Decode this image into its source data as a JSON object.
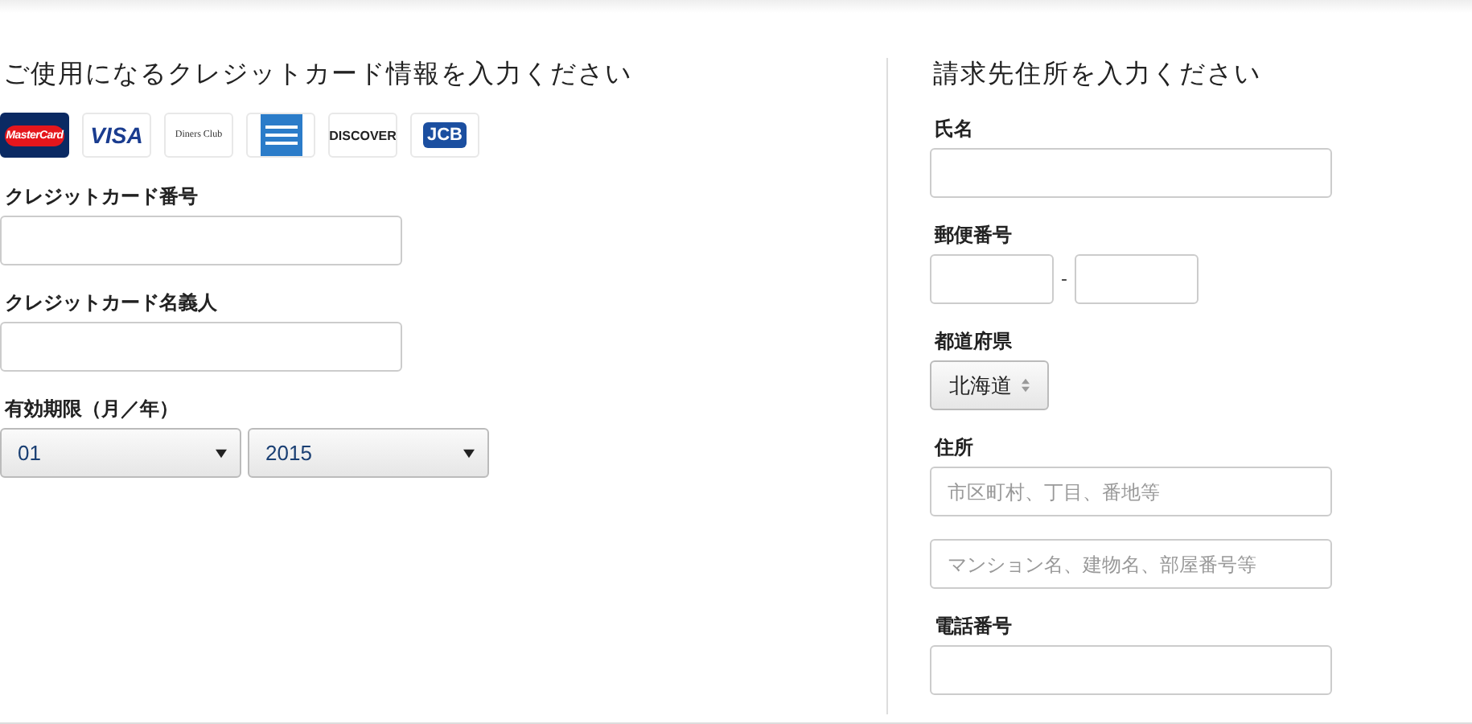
{
  "card_section": {
    "title": "ご使用になるクレジットカード情報を入力ください",
    "card_logos": [
      {
        "kind": "mastercard",
        "text": "MasterCard"
      },
      {
        "kind": "visa",
        "text": "VISA"
      },
      {
        "kind": "diners",
        "text": "Diners Club"
      },
      {
        "kind": "amex"
      },
      {
        "kind": "discover",
        "text": "DISCOVER"
      },
      {
        "kind": "jcb",
        "text": "JCB"
      }
    ],
    "fields": [
      {
        "kind": "text",
        "label": "クレジットカード番号"
      },
      {
        "kind": "text",
        "label": "クレジットカード名義人"
      },
      {
        "kind": "expiry",
        "label": "有効期限（月／年）",
        "month": "01",
        "year": "2015"
      }
    ]
  },
  "billing_section": {
    "title": "請求先住所を入力ください",
    "fields": [
      {
        "kind": "text",
        "label": "氏名"
      },
      {
        "kind": "postal",
        "label": "郵便番号",
        "separator": "-"
      },
      {
        "kind": "prefecture",
        "label": "都道府県",
        "value": "北海道"
      },
      {
        "kind": "address",
        "label": "住所",
        "placeholders": [
          "市区町村、丁目、番地等",
          "マンション名、建物名、部屋番号等"
        ]
      },
      {
        "kind": "text",
        "label": "電話番号"
      }
    ]
  }
}
